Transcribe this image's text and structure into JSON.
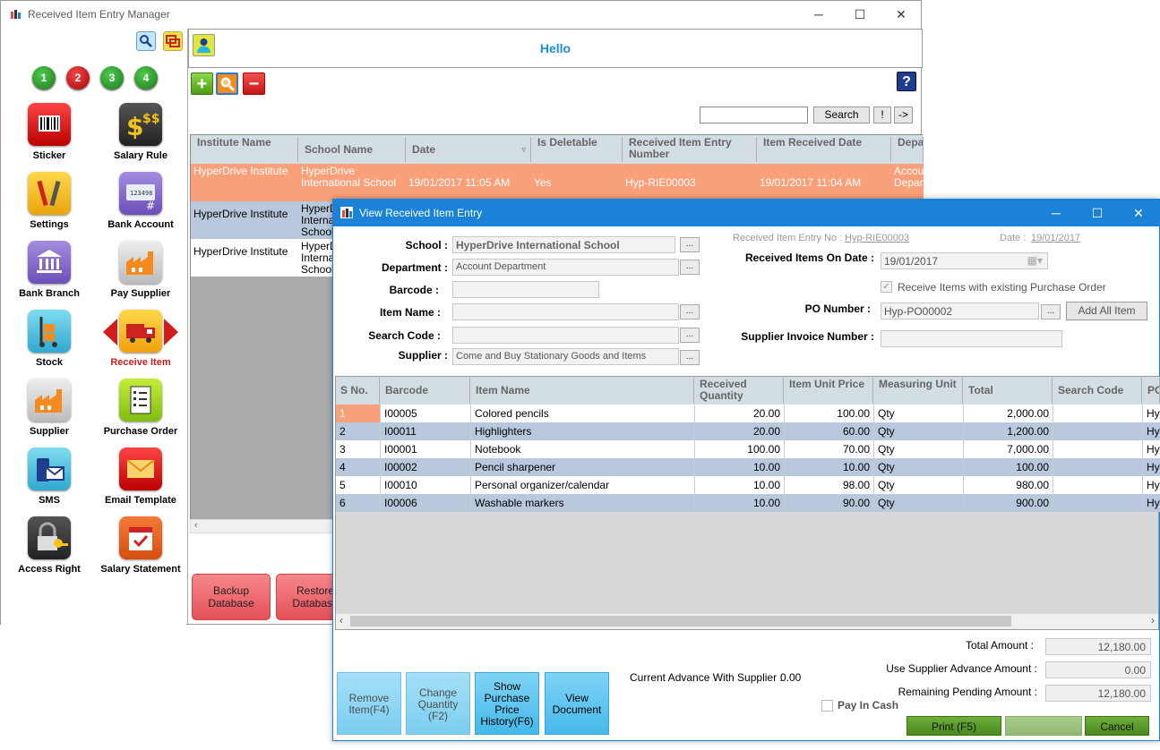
{
  "main_window": {
    "title": "Received Item Entry Manager",
    "controls": [
      "─",
      "☐",
      "✕"
    ]
  },
  "sidebar": {
    "numbers": [
      "1",
      "2",
      "3",
      "4"
    ],
    "tiles": [
      {
        "label": "Sticker",
        "icon": "barcode-icon"
      },
      {
        "label": "Salary Rule",
        "icon": "money-bag-icon"
      },
      {
        "label": "Settings",
        "icon": "tools-icon"
      },
      {
        "label": "Bank Account",
        "icon": "bank-card-icon"
      },
      {
        "label": "Bank Branch",
        "icon": "bank-building-icon"
      },
      {
        "label": "Pay Supplier",
        "icon": "factory-icon"
      },
      {
        "label": "Stock",
        "icon": "hand-truck-icon"
      },
      {
        "label": "Receive Item",
        "icon": "truck-icon"
      },
      {
        "label": "Supplier",
        "icon": "factory-icon"
      },
      {
        "label": "Purchase Order",
        "icon": "checklist-icon"
      },
      {
        "label": "SMS",
        "icon": "phone-mail-icon"
      },
      {
        "label": "Email Template",
        "icon": "envelope-icon"
      },
      {
        "label": "Access Right",
        "icon": "lock-key-icon"
      },
      {
        "label": "Salary Statement",
        "icon": "calendar-check-icon"
      }
    ]
  },
  "header": {
    "greeting": "Hello"
  },
  "toolbar": {
    "add": "+",
    "remove": "−",
    "help": "?"
  },
  "search": {
    "button": "Search",
    "bang": "!",
    "arrow": "->"
  },
  "grid1": {
    "columns": [
      "Institute Name",
      "School Name",
      "Date",
      "Is Deletable",
      "Received Item Entry Number",
      "Item Received Date",
      "Department Name"
    ],
    "rows": [
      [
        "HyperDrive Institute",
        "HyperDrive International School",
        "19/01/2017 11:05 AM",
        "Yes",
        "Hyp-RIE00003",
        "19/01/2017 11:04 AM",
        "Account Department"
      ],
      [
        "HyperDrive Institute",
        "HyperDrive International School",
        "",
        "",
        "",
        "",
        ""
      ],
      [
        "HyperDrive Institute",
        "HyperDrive International School",
        "",
        "",
        "",
        "",
        ""
      ]
    ]
  },
  "bottom_buttons": {
    "backup": "Backup Database",
    "restore": "Restore Database"
  },
  "dialog": {
    "title": "View Received Item Entry",
    "controls": [
      "─",
      "☐",
      "✕"
    ],
    "labels": {
      "school": "School :",
      "department": "Department :",
      "barcode": "Barcode :",
      "item_name": "Item Name :",
      "search_code": "Search Code :",
      "supplier": "Supplier :",
      "entry_no": "Received Item Entry No :",
      "date": "Date :",
      "received_on": "Received Items On Date :",
      "receive_existing": "Receive Items with existing Purchase Order",
      "po_number": "PO Number :",
      "supplier_invoice": "Supplier Invoice Number :"
    },
    "values": {
      "school": "HyperDrive International School",
      "department": "Account Department",
      "supplier": "Come and Buy Stationary Goods and Items",
      "entry_no": "Hyp-RIE00003",
      "date": "19/01/2017",
      "received_on": "19/01/2017",
      "po_number": "Hyp-PO00002"
    },
    "dots": "...",
    "add_all": "Add All Item",
    "items_table": {
      "columns": [
        "S No.",
        "Barcode",
        "Item Name",
        "Received Quantity",
        "Item Unit Price",
        "Measuring Unit",
        "Total",
        "Search Code",
        "PO"
      ],
      "rows": [
        [
          "1",
          "I00005",
          "Colored pencils",
          "20.00",
          "100.00",
          "Qty",
          "2,000.00",
          "",
          "Hy"
        ],
        [
          "2",
          "I00011",
          "Highlighters",
          "20.00",
          "60.00",
          "Qty",
          "1,200.00",
          "",
          "Hy"
        ],
        [
          "3",
          "I00001",
          "Notebook",
          "100.00",
          "70.00",
          "Qty",
          "7,000.00",
          "",
          "Hy"
        ],
        [
          "4",
          "I00002",
          "Pencil sharpener",
          "10.00",
          "10.00",
          "Qty",
          "100.00",
          "",
          "Hy"
        ],
        [
          "5",
          "I00010",
          "Personal organizer/calendar",
          "10.00",
          "98.00",
          "Qty",
          "980.00",
          "",
          "Hy"
        ],
        [
          "6",
          "I00006",
          "Washable markers",
          "10.00",
          "90.00",
          "Qty",
          "900.00",
          "",
          "Hy"
        ]
      ]
    },
    "side_buttons": {
      "remove": "Remove Item(F4)",
      "change": "Change Quantity (F2)",
      "history": "Show Purchase Price History(F6)",
      "view_doc": "View Document"
    },
    "advance": {
      "label": "Current Advance With Supplier :",
      "value": "0.00"
    },
    "pay_in_cash": "Pay In Cash",
    "summary": {
      "total_label": "Total Amount :",
      "total": "12,180.00",
      "advance_label": "Use Supplier Advance Amount :",
      "advance": "0.00",
      "pending_label": "Remaining Pending Amount :",
      "pending": "12,180.00"
    },
    "print": "Print (F5)",
    "cancel": "Cancel"
  }
}
